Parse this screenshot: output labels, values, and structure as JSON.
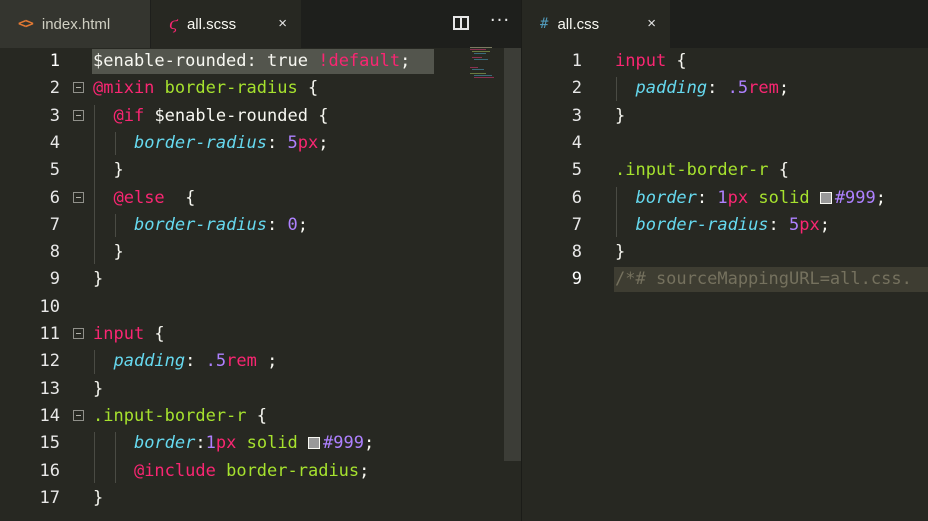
{
  "left_pane": {
    "tabs": [
      {
        "label": "index.html",
        "icon": "code-icon",
        "active": false
      },
      {
        "label": "all.scss",
        "icon": "sass-icon",
        "active": true,
        "close": "×"
      }
    ],
    "actions": {
      "split_editor": "split-editor-icon",
      "more": "···"
    },
    "lines": [
      {
        "n": "1",
        "tokens": [
          [
            "$enable-rounded",
            "t-var"
          ],
          [
            ": ",
            "t-punc"
          ],
          [
            "true",
            "t-var"
          ],
          [
            " ",
            "t-punc"
          ],
          [
            "!default",
            "t-flag"
          ],
          [
            ";",
            "t-punc"
          ]
        ]
      },
      {
        "n": "2",
        "tokens": [
          [
            "@mixin",
            "t-at"
          ],
          [
            " ",
            "t-punc"
          ],
          [
            "border-radius",
            "t-name"
          ],
          [
            " {",
            "t-punc"
          ]
        ]
      },
      {
        "n": "3",
        "tokens": [
          [
            "  ",
            "t-punc"
          ],
          [
            "@if",
            "t-at"
          ],
          [
            " $enable-rounded {",
            "t-punc"
          ]
        ]
      },
      {
        "n": "4",
        "tokens": [
          [
            "    ",
            "t-punc"
          ],
          [
            "border-radius",
            "t-prop"
          ],
          [
            ": ",
            "t-punc"
          ],
          [
            "5",
            "t-num"
          ],
          [
            "px",
            "t-unit"
          ],
          [
            ";",
            "t-punc"
          ]
        ]
      },
      {
        "n": "5",
        "tokens": [
          [
            "  }",
            "t-punc"
          ]
        ]
      },
      {
        "n": "6",
        "tokens": [
          [
            "  ",
            "t-punc"
          ],
          [
            "@else",
            "t-at"
          ],
          [
            "  {",
            "t-punc"
          ]
        ]
      },
      {
        "n": "7",
        "tokens": [
          [
            "    ",
            "t-punc"
          ],
          [
            "border-radius",
            "t-prop"
          ],
          [
            ": ",
            "t-punc"
          ],
          [
            "0",
            "t-num"
          ],
          [
            ";",
            "t-punc"
          ]
        ]
      },
      {
        "n": "8",
        "tokens": [
          [
            "  }",
            "t-punc"
          ]
        ]
      },
      {
        "n": "9",
        "tokens": [
          [
            "}",
            "t-punc"
          ]
        ]
      },
      {
        "n": "10",
        "tokens": []
      },
      {
        "n": "11",
        "tokens": [
          [
            "input",
            "t-tag"
          ],
          [
            " {",
            "t-punc"
          ]
        ]
      },
      {
        "n": "12",
        "tokens": [
          [
            "  ",
            "t-punc"
          ],
          [
            "padding",
            "t-prop"
          ],
          [
            ": ",
            "t-punc"
          ],
          [
            ".5",
            "t-num"
          ],
          [
            "rem",
            "t-unit"
          ],
          [
            " ;",
            "t-punc"
          ]
        ]
      },
      {
        "n": "13",
        "tokens": [
          [
            "}",
            "t-punc"
          ]
        ]
      },
      {
        "n": "14",
        "tokens": [
          [
            ".input-border-r",
            "t-sel"
          ],
          [
            " {",
            "t-punc"
          ]
        ]
      },
      {
        "n": "15",
        "tokens": [
          [
            "    ",
            "t-punc"
          ],
          [
            "border",
            "t-prop"
          ],
          [
            ":",
            "t-punc"
          ],
          [
            "1",
            "t-num"
          ],
          [
            "px",
            "t-unit"
          ],
          [
            " ",
            "t-punc"
          ],
          [
            "solid",
            "t-val"
          ],
          [
            " ",
            "t-punc"
          ],
          [
            "SWATCH",
            "swatch"
          ],
          [
            "#999",
            "t-hex"
          ],
          [
            ";",
            "t-punc"
          ]
        ]
      },
      {
        "n": "16",
        "tokens": [
          [
            "    ",
            "t-punc"
          ],
          [
            "@include",
            "t-at"
          ],
          [
            " ",
            "t-punc"
          ],
          [
            "border-radius",
            "t-name"
          ],
          [
            ";",
            "t-punc"
          ]
        ]
      },
      {
        "n": "17",
        "tokens": [
          [
            "}",
            "t-punc"
          ]
        ]
      }
    ]
  },
  "right_pane": {
    "tabs": [
      {
        "label": "all.css",
        "icon": "css-icon",
        "active": true,
        "close": "×"
      }
    ],
    "lines": [
      {
        "n": "1",
        "tokens": [
          [
            "input",
            "t-tag"
          ],
          [
            " {",
            "t-punc"
          ]
        ]
      },
      {
        "n": "2",
        "tokens": [
          [
            "  ",
            "t-punc"
          ],
          [
            "padding",
            "t-prop"
          ],
          [
            ": ",
            "t-punc"
          ],
          [
            ".5",
            "t-num"
          ],
          [
            "rem",
            "t-unit"
          ],
          [
            ";",
            "t-punc"
          ]
        ]
      },
      {
        "n": "3",
        "tokens": [
          [
            "}",
            "t-punc"
          ]
        ]
      },
      {
        "n": "4",
        "tokens": []
      },
      {
        "n": "5",
        "tokens": [
          [
            ".input-border-r",
            "t-sel"
          ],
          [
            " {",
            "t-punc"
          ]
        ]
      },
      {
        "n": "6",
        "tokens": [
          [
            "  ",
            "t-punc"
          ],
          [
            "border",
            "t-prop"
          ],
          [
            ": ",
            "t-punc"
          ],
          [
            "1",
            "t-num"
          ],
          [
            "px",
            "t-unit"
          ],
          [
            " ",
            "t-punc"
          ],
          [
            "solid",
            "t-val"
          ],
          [
            " ",
            "t-punc"
          ],
          [
            "SWATCH",
            "swatch"
          ],
          [
            "#999",
            "t-hex"
          ],
          [
            ";",
            "t-punc"
          ]
        ]
      },
      {
        "n": "7",
        "tokens": [
          [
            "  ",
            "t-punc"
          ],
          [
            "border-radius",
            "t-prop"
          ],
          [
            ": ",
            "t-punc"
          ],
          [
            "5",
            "t-num"
          ],
          [
            "px",
            "t-unit"
          ],
          [
            ";",
            "t-punc"
          ]
        ]
      },
      {
        "n": "8",
        "tokens": [
          [
            "}",
            "t-punc"
          ]
        ]
      },
      {
        "n": "9",
        "tokens": [
          [
            "/*# sourceMappingURL=all.css.",
            "t-com"
          ]
        ]
      }
    ]
  },
  "colors": {
    "editor_bg": "#272822",
    "tabbar_bg": "#1e1f1c",
    "inactive_tab_bg": "#34352f",
    "keyword_pink": "#f92672",
    "function_green": "#a6e22e",
    "property_blue": "#66d9ef",
    "number_purple": "#ae81ff",
    "comment_gray": "#75715e",
    "swatch_color": "#999999"
  }
}
